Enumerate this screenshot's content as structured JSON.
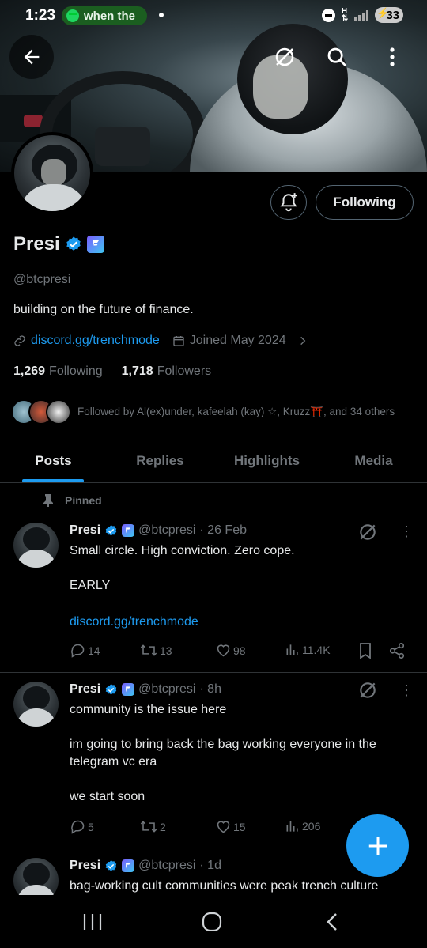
{
  "status_bar": {
    "time": "1:23",
    "media_pill": "when the",
    "battery": "33"
  },
  "profile": {
    "name": "Presi",
    "handle": "@btcpresi",
    "bio": "building on the future of finance.",
    "link": "discord.gg/trenchmode",
    "joined": "Joined May 2024",
    "following_count": "1,269",
    "following_label": "Following",
    "followers_count": "1,718",
    "followers_label": "Followers",
    "followed_by": "Followed by Al(ex)under, kafeelah (kay) ☆, Kruzz⛩️, and 34 others",
    "follow_button": "Following"
  },
  "tabs": [
    "Posts",
    "Replies",
    "Highlights",
    "Media"
  ],
  "pinned_label": "Pinned",
  "posts": [
    {
      "name": "Presi",
      "handle": "@btcpresi",
      "time": "· 26 Feb",
      "text": "Small circle. High conviction. Zero cope.\n\nEARLY",
      "link": "discord.gg/trenchmode",
      "replies": "14",
      "reposts": "13",
      "likes": "98",
      "views": "11.4K"
    },
    {
      "name": "Presi",
      "handle": "@btcpresi",
      "time": "· 8h",
      "text": "community is the issue here\n\nim going to bring back the bag working everyone in the telegram vc era\n\nwe start soon",
      "replies": "5",
      "reposts": "2",
      "likes": "15",
      "views": "206"
    },
    {
      "name": "Presi",
      "handle": "@btcpresi",
      "time": "· 1d",
      "text": "bag-working cult communities were peak trench culture"
    }
  ]
}
